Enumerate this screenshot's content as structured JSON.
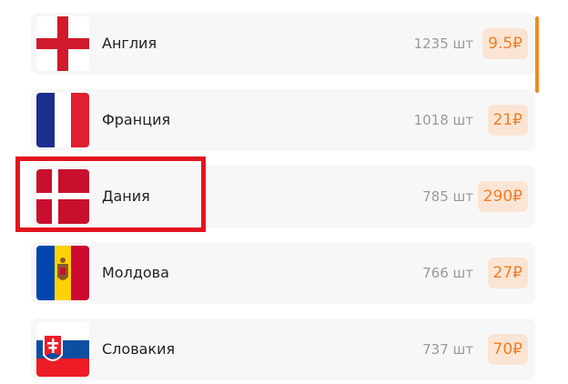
{
  "rows": [
    {
      "country": "Англия",
      "count": "1235 шт",
      "price": "9.5₽",
      "flag": "england-flag-icon"
    },
    {
      "country": "Франция",
      "count": "1018 шт",
      "price": "21₽",
      "flag": "france-flag-icon"
    },
    {
      "country": "Дания",
      "count": "785 шт",
      "price": "290₽",
      "flag": "denmark-flag-icon"
    },
    {
      "country": "Молдова",
      "count": "766 шт",
      "price": "27₽",
      "flag": "moldova-flag-icon"
    },
    {
      "country": "Словакия",
      "count": "737 шт",
      "price": "70₽",
      "flag": "slovakia-flag-icon"
    }
  ],
  "colors": {
    "accent": "#ef7e26",
    "price_bg": "#fbe4d3",
    "highlight": "#e2151f",
    "row_bg": "#f7f7f7"
  },
  "highlighted_row": "Дания"
}
